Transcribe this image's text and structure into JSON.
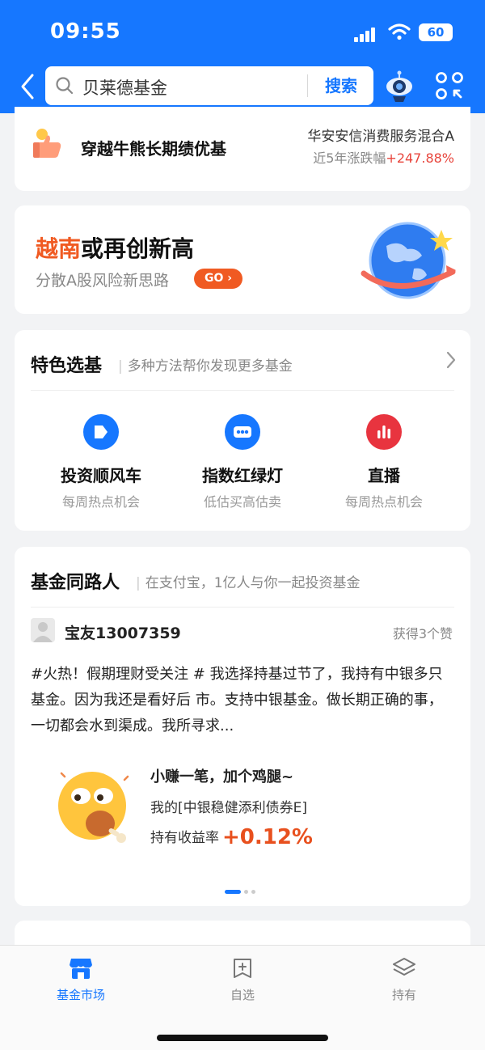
{
  "status_bar": {
    "time": "09:55",
    "battery": "60"
  },
  "search": {
    "value": "贝莱德基金",
    "button_label": "搜索"
  },
  "promo_fund": {
    "title": "穿越牛熊长期绩优基",
    "fund_name": "华安安信消费服务混合A",
    "perf_label": "近5年涨跌幅",
    "perf_value": "+247.88%"
  },
  "banner": {
    "headline_highlight": "越南",
    "headline_rest": "或再创新高",
    "subtitle": "分散A股风险新思路",
    "go_label": "GO"
  },
  "featured": {
    "title": "特色选基",
    "subtitle": "多种方法帮你发现更多基金",
    "items": [
      {
        "label": "投资顺风车",
        "sublabel": "每周热点机会",
        "icon": "tag-icon",
        "color": "#1677ff"
      },
      {
        "label": "指数红绿灯",
        "sublabel": "低估买高估卖",
        "icon": "traffic-light-icon",
        "color": "#1677ff"
      },
      {
        "label": "直播",
        "sublabel": "每周热点机会",
        "icon": "bar-chart-icon",
        "color": "#e8343f"
      }
    ]
  },
  "community": {
    "title": "基金同路人",
    "subtitle": "在支付宝，1亿人与你一起投资基金",
    "username": "宝友13007359",
    "likes": "获得3个赞",
    "post_text": "#火热！假期理财受关注 # 我选择持基过节了，我持有中银多只基金。因为我还是看好后 市。支持中银基金。做长期正确的事，一切都会水到渠成。我所寻求...",
    "note_title": "小赚一笔，加个鸡腿~",
    "note_fund": "我的[中银稳健添利债券E]",
    "note_rate_label": "持有收益率",
    "note_rate_value": "+0.12%"
  },
  "tabbar": {
    "tabs": [
      {
        "label": "基金市场",
        "icon": "store-icon",
        "active": true
      },
      {
        "label": "自选",
        "icon": "add-favorite-icon",
        "active": false
      },
      {
        "label": "持有",
        "icon": "layers-icon",
        "active": false
      }
    ]
  },
  "colors": {
    "brand": "#1677ff",
    "up": "#e8453c",
    "accent": "#f05a22"
  }
}
